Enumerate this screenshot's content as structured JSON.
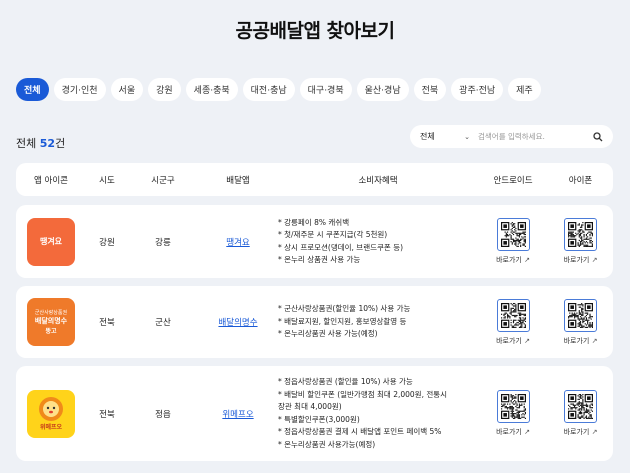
{
  "page": {
    "title": "공공배달앱 찾아보기"
  },
  "tabs": [
    "전체",
    "경기·인천",
    "서울",
    "강원",
    "세종·충북",
    "대전·충남",
    "대구·경북",
    "울산·경남",
    "전북",
    "광주·전남",
    "제주"
  ],
  "summary": {
    "prefix": "전체 ",
    "count": "52",
    "suffix": "건"
  },
  "search": {
    "select_value": "전체",
    "placeholder": "검색어를 입력하세요."
  },
  "table": {
    "headers": {
      "icon": "앱 아이콘",
      "sido": "시도",
      "sigungu": "시군구",
      "app": "배달앱",
      "benefit": "소비자혜택",
      "android": "안드로이드",
      "iphone": "아이폰"
    },
    "link_label": "바로가기",
    "rows": [
      {
        "logo_text": "땡겨요",
        "sido": "강원",
        "sigungu": "강릉",
        "app": "땡겨요",
        "benefits": [
          "* 강릉페이 8% 캐쉬백",
          "* 첫/재주문 시 쿠폰지급(각 5천원)",
          "* 상시 프로모션(댕데이, 브랜드쿠폰 등)",
          "* 온누리 상품권 사용 가능"
        ]
      },
      {
        "logo_text_top": "군산사랑상품권",
        "logo_text": "배달의명수",
        "logo_text_bottom": "뚱고",
        "sido": "전북",
        "sigungu": "군산",
        "app": "배달의명수",
        "benefits": [
          "* 군산사랑상품권(할인율 10%) 사용 가능",
          "* 배달료지원, 할인지원, 홍보영상촬영 등",
          "* 온누리상품권 사용 가능(예정)"
        ]
      },
      {
        "logo_text": "위메프오",
        "sido": "전북",
        "sigungu": "정읍",
        "app": "위메프오",
        "benefits": [
          "* 정읍사랑상품권 (할인율 10%) 사용 가능",
          "* 배달비 할인쿠폰 (일반가맹점 최대 2,000원, 전통시",
          "장관 최대 4,000원)",
          "* 특별할인쿠폰(3,000원)",
          "* 정읍사랑상품권 결제 시 배달앱 포인트 페이백 5%",
          "* 온누리상품권 사용가능(예정)"
        ]
      }
    ]
  },
  "colors": {
    "accent": "#1a5ad7",
    "background": "#eef1f6"
  },
  "icons": {
    "search": "search-icon",
    "chevron": "chevron-down-icon",
    "external": "external-link-icon",
    "qr": "qr-code-icon"
  }
}
